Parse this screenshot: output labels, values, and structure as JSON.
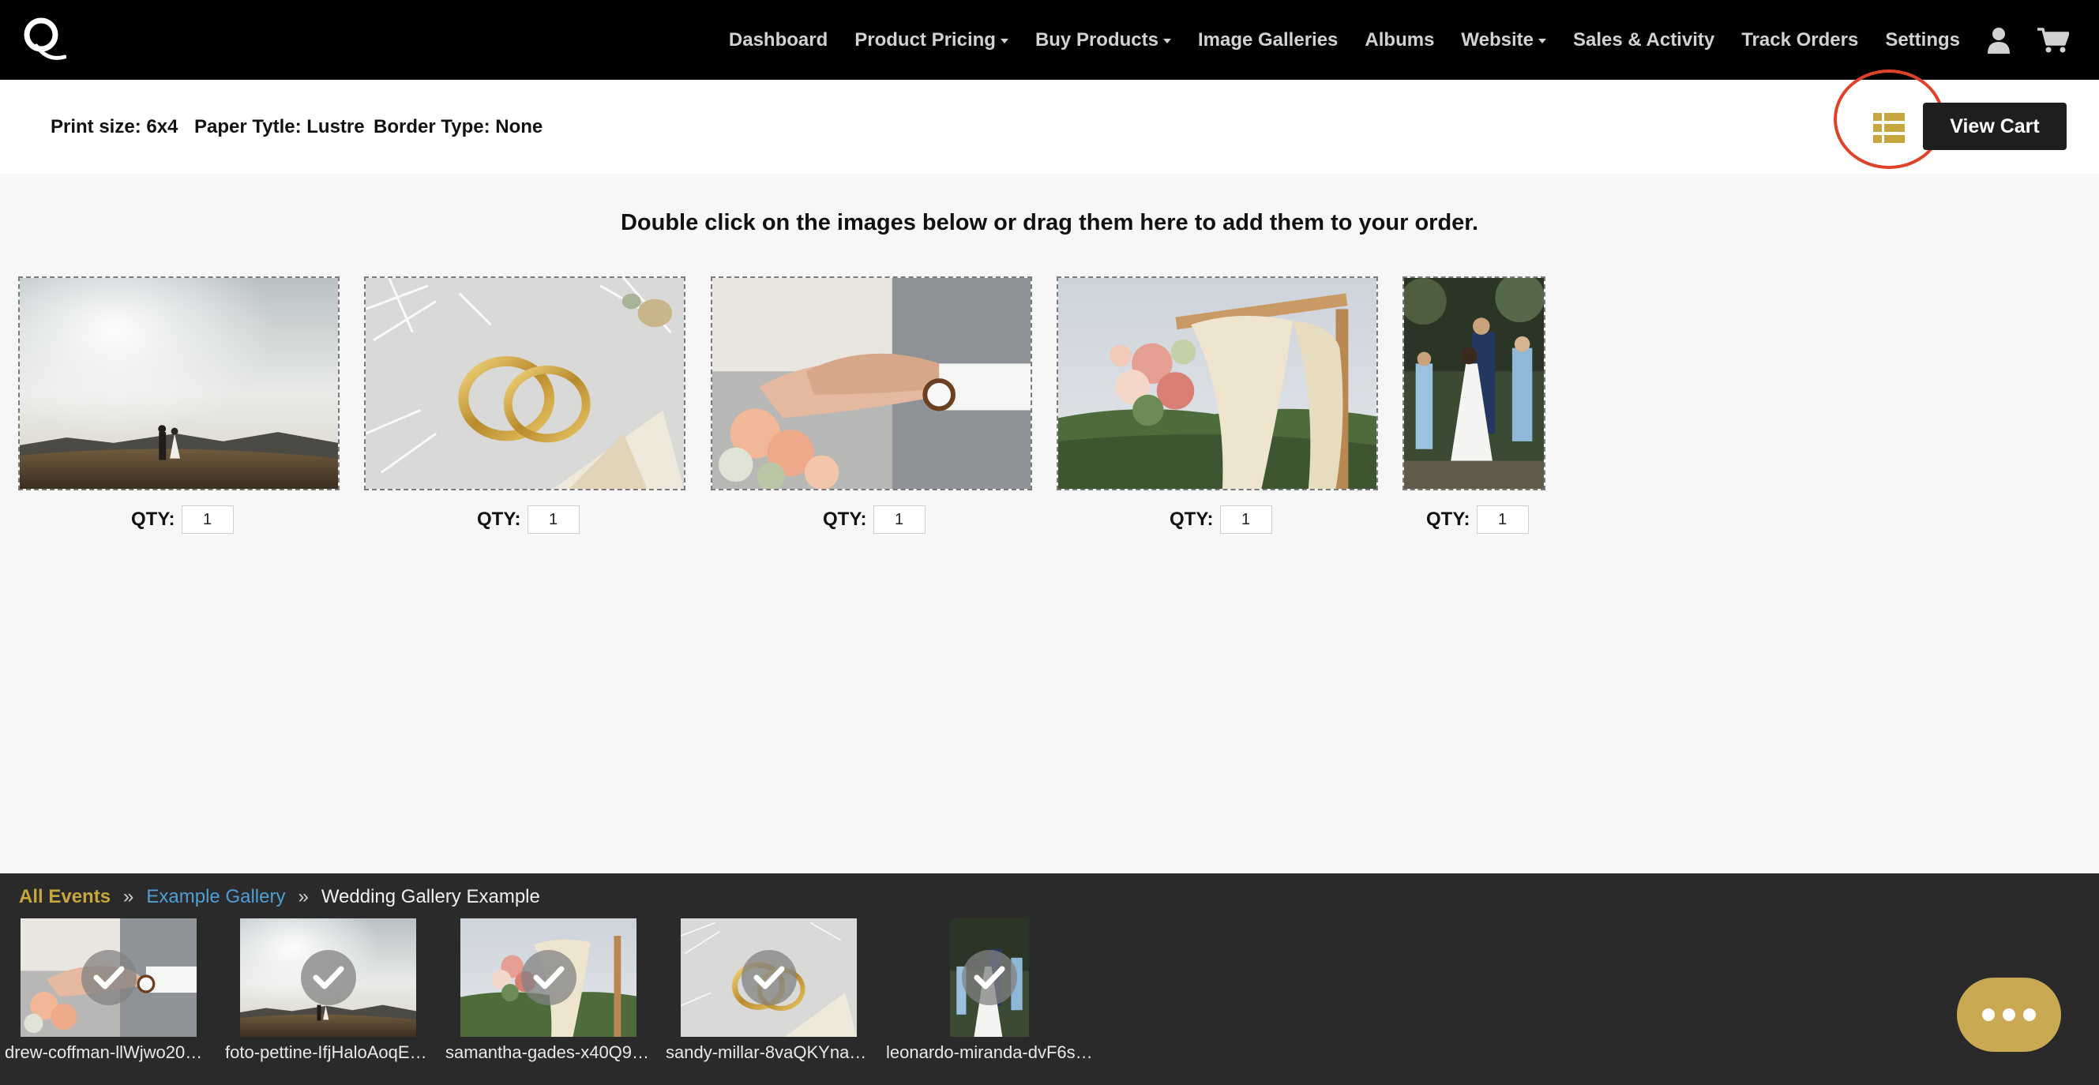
{
  "nav": {
    "items": [
      {
        "label": "Dashboard",
        "dropdown": false
      },
      {
        "label": "Product Pricing",
        "dropdown": true
      },
      {
        "label": "Buy Products",
        "dropdown": true
      },
      {
        "label": "Image Galleries",
        "dropdown": false
      },
      {
        "label": "Albums",
        "dropdown": false
      },
      {
        "label": "Website",
        "dropdown": true
      },
      {
        "label": "Sales & Activity",
        "dropdown": false
      },
      {
        "label": "Track Orders",
        "dropdown": false
      },
      {
        "label": "Settings",
        "dropdown": false
      }
    ],
    "icons": [
      "user-icon",
      "cart-icon"
    ]
  },
  "options": {
    "print_size": "Print size: 6x4",
    "paper_type": "Paper Tytle: Lustre",
    "border_type": "Border Type: None",
    "view_cart_label": "View Cart"
  },
  "instruction": "Double click on the images below or drag them here to add them to your order.",
  "order": {
    "qty_label": "QTY:",
    "items": [
      {
        "scene": "couple-landscape",
        "qty": "1"
      },
      {
        "scene": "wedding-rings",
        "qty": "1"
      },
      {
        "scene": "hands-bouquet",
        "qty": "1"
      },
      {
        "scene": "floral-arch",
        "qty": "1"
      },
      {
        "scene": "couple-kiss",
        "qty": "1"
      }
    ]
  },
  "gallery": {
    "breadcrumb": {
      "all_events": "All Events",
      "sep": "»",
      "example": "Example Gallery",
      "current": "Wedding Gallery Example"
    },
    "thumbs": [
      {
        "label": "drew-coffman-llWjwo20…",
        "scene": "hands-bouquet"
      },
      {
        "label": "foto-pettine-IfjHaloAoqE…",
        "scene": "couple-landscape"
      },
      {
        "label": "samantha-gades-x40Q9j…",
        "scene": "floral-arch"
      },
      {
        "label": "sandy-millar-8vaQKYna…",
        "scene": "wedding-rings"
      },
      {
        "label": "leonardo-miranda-dvF6s…",
        "scene": "couple-kiss"
      }
    ]
  },
  "colors": {
    "accent_gold": "#c7a53f",
    "highlight_red": "#e0412b",
    "link_blue": "#4e9fd6",
    "nav_bg": "#000000"
  }
}
